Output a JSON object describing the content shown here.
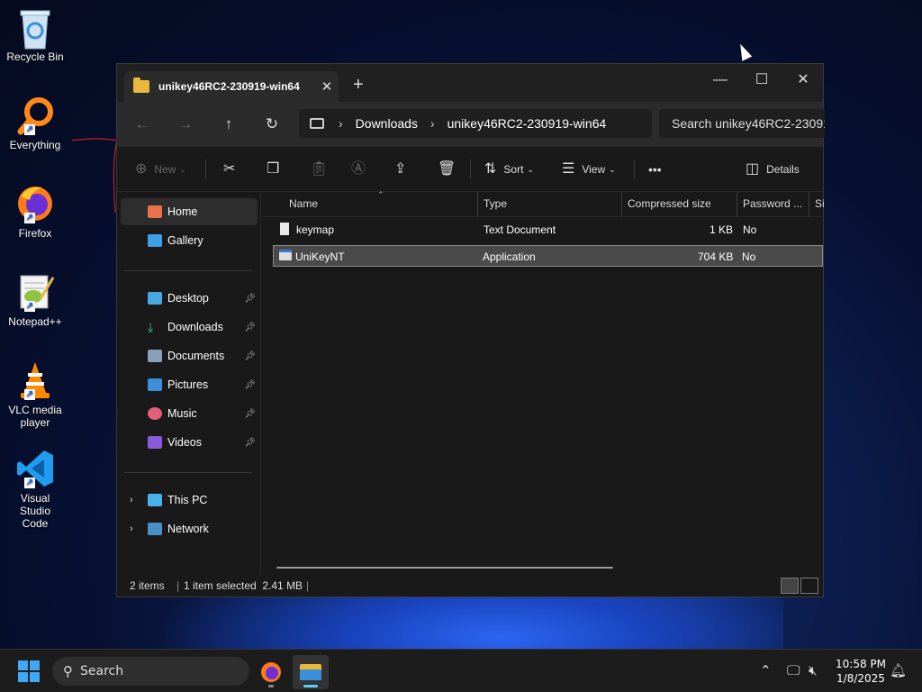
{
  "desktop": {
    "icons": [
      {
        "label": "Recycle Bin",
        "icon": "recycle-bin-icon"
      },
      {
        "label": "Everything",
        "icon": "everything-search-icon"
      },
      {
        "label": "Firefox",
        "icon": "firefox-icon"
      },
      {
        "label": "Notepad++",
        "icon": "notepad-plus-plus-icon"
      },
      {
        "label": "VLC media player",
        "icon": "vlc-cone-icon"
      },
      {
        "label": "Visual Studio Code",
        "icon": "vscode-icon"
      }
    ]
  },
  "window": {
    "tab_title": "unikey46RC2-230919-win64",
    "address": [
      "Downloads",
      "unikey46RC2-230919-win64"
    ],
    "search_placeholder": "Search unikey46RC2-23091"
  },
  "toolbar": {
    "new_label": "New",
    "sort_label": "Sort",
    "view_label": "View",
    "more_label": "•••",
    "details_label": "Details"
  },
  "sidebar": {
    "items": [
      {
        "label": "Home"
      },
      {
        "label": "Gallery"
      },
      {
        "label": "Desktop"
      },
      {
        "label": "Downloads"
      },
      {
        "label": "Documents"
      },
      {
        "label": "Pictures"
      },
      {
        "label": "Music"
      },
      {
        "label": "Videos"
      },
      {
        "label": "This PC"
      },
      {
        "label": "Network"
      }
    ]
  },
  "columns": {
    "name": "Name",
    "type": "Type",
    "compressed_size": "Compressed size",
    "password": "Password ...",
    "size": "Si"
  },
  "files": [
    {
      "name": "keymap",
      "type": "Text Document",
      "compressed_size": "1 KB",
      "password": "No"
    },
    {
      "name": "UniKeyNT",
      "type": "Application",
      "compressed_size": "704 KB",
      "password": "No"
    }
  ],
  "status": {
    "items": "2 items",
    "selected": "1 item selected  2.41 MB"
  },
  "taskbar": {
    "search_label": "Search",
    "time": "10:58 PM",
    "date": "1/8/2025"
  },
  "colors": {
    "accent": "#60cdff",
    "folder": "#e8b93c",
    "window_bg": "#191919"
  }
}
